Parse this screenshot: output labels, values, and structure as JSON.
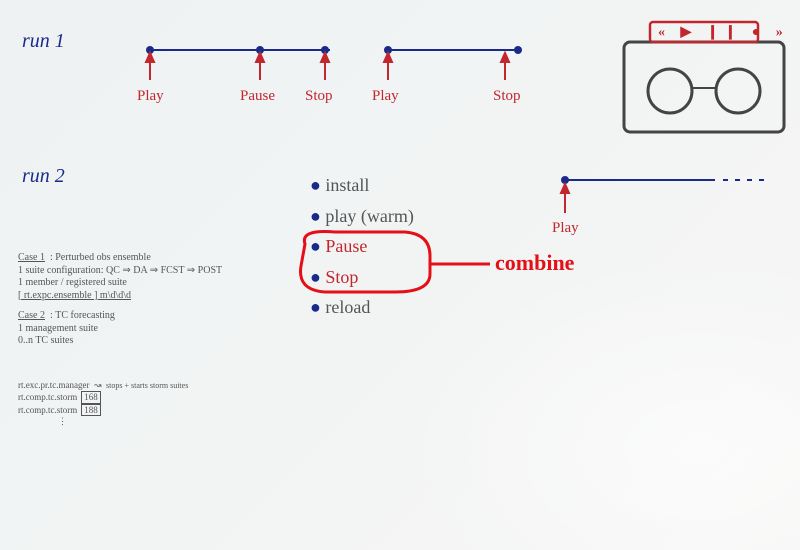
{
  "run1": {
    "title": "run 1",
    "events": [
      "Play",
      "Pause",
      "Stop",
      "Play",
      "Stop"
    ]
  },
  "run2": {
    "title": "run 2",
    "events": [
      "Play"
    ],
    "actions": [
      "install",
      "play  (warm)",
      "Pause",
      "Stop",
      "reload"
    ],
    "combine_label": "combine"
  },
  "cassette": {
    "controls": [
      "«",
      "▶",
      "❙❙",
      "●",
      "»"
    ]
  },
  "notes": {
    "case1_title": "Case 1",
    "case1_desc": "Perturbed obs ensemble",
    "case1_line1": "1 suite configuration:  QC ⇒ DA ⇒ FCST ⇒ POST",
    "case1_line2": "1 member / registered suite",
    "case1_line3": "[ rt.expc.ensemble ]  m\\d\\d\\d",
    "case2_title": "Case 2",
    "case2_desc": "TC forecasting",
    "case2_line1": "1 management suite",
    "case2_line2": "0..n TC suites",
    "stack_l1": "rt.exc.pr.tc.manager",
    "stack_l1_tag": "stops + starts storm suites",
    "stack_l2": "rt.comp.tc.storm",
    "stack_l3": "rt.comp.tc.storm",
    "box_top": "168",
    "box_bot": "188"
  }
}
